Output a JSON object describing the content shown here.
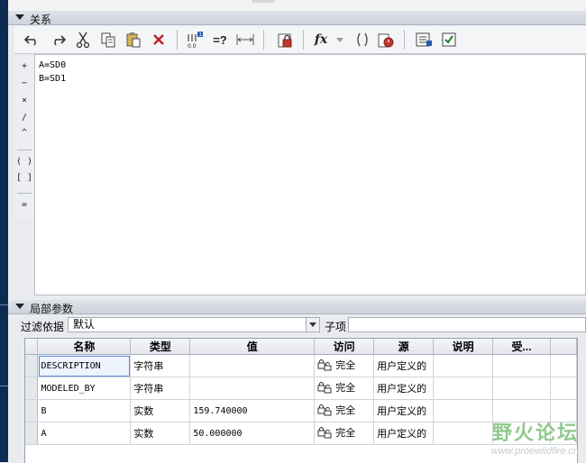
{
  "sections": {
    "relations": "关系",
    "local_params": "局部参数"
  },
  "toolbar": {
    "icons": [
      "undo-icon",
      "redo-icon",
      "cut-icon",
      "copy-icon",
      "paste-icon",
      "delete-icon",
      "evaluate-icon",
      "verify-icon",
      "dimension-icon",
      "lock-icon",
      "function-icon",
      "parentheses-icon",
      "timer-icon",
      "list-icon",
      "check-icon"
    ],
    "verify_label": "=?",
    "function_label": "fx"
  },
  "operators": [
    "+",
    "−",
    "×",
    "/",
    "^",
    "( )",
    "[ ]",
    "="
  ],
  "editor": {
    "lines": [
      "A=SD0",
      "B=SD1"
    ]
  },
  "filter": {
    "label": "过滤依据",
    "value": "默认",
    "sub_label": "子项",
    "sub_value": ""
  },
  "table": {
    "columns": [
      "名称",
      "类型",
      "值",
      "访问",
      "源",
      "说明",
      "受..."
    ],
    "rows": [
      {
        "name": "DESCRIPTION",
        "type": "字符串",
        "value": "",
        "access": "完全",
        "source": "用户定义的",
        "desc": "",
        "restricted": ""
      },
      {
        "name": "MODELED_BY",
        "type": "字符串",
        "value": "",
        "access": "完全",
        "source": "用户定义的",
        "desc": "",
        "restricted": ""
      },
      {
        "name": "B",
        "type": "实数",
        "value": "159.740000",
        "access": "完全",
        "source": "用户定义的",
        "desc": "",
        "restricted": ""
      },
      {
        "name": "A",
        "type": "实数",
        "value": "50.000000",
        "access": "完全",
        "source": "用户定义的",
        "desc": "",
        "restricted": ""
      }
    ]
  },
  "watermark": {
    "title": "野火论坛",
    "url": "www.proewildfire.cn"
  }
}
